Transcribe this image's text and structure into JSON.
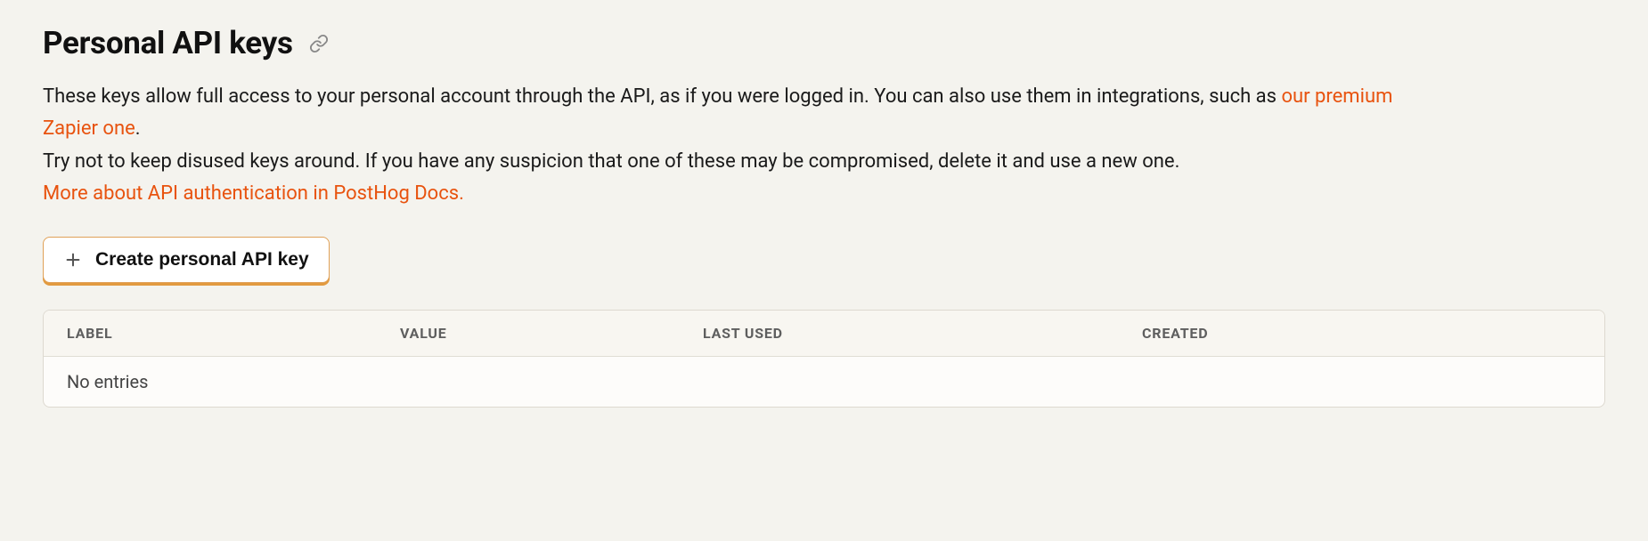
{
  "page": {
    "title": "Personal API keys"
  },
  "description": {
    "line1_prefix": "These keys allow full access to your personal account through the API, as if you were logged in. You can also use them in integrations, such as ",
    "zapier_link": "our premium Zapier one",
    "line1_suffix": ".",
    "line2": "Try not to keep disused keys around. If you have any suspicion that one of these may be compromised, delete it and use a new one.",
    "docs_link": "More about API authentication in PostHog Docs."
  },
  "actions": {
    "create_label": "Create personal API key"
  },
  "table": {
    "columns": {
      "label": "LABEL",
      "value": "VALUE",
      "last_used": "LAST USED",
      "created": "CREATED"
    },
    "empty": "No entries"
  },
  "colors": {
    "link": "#e8530f",
    "border_accent": "#e29a3f"
  }
}
